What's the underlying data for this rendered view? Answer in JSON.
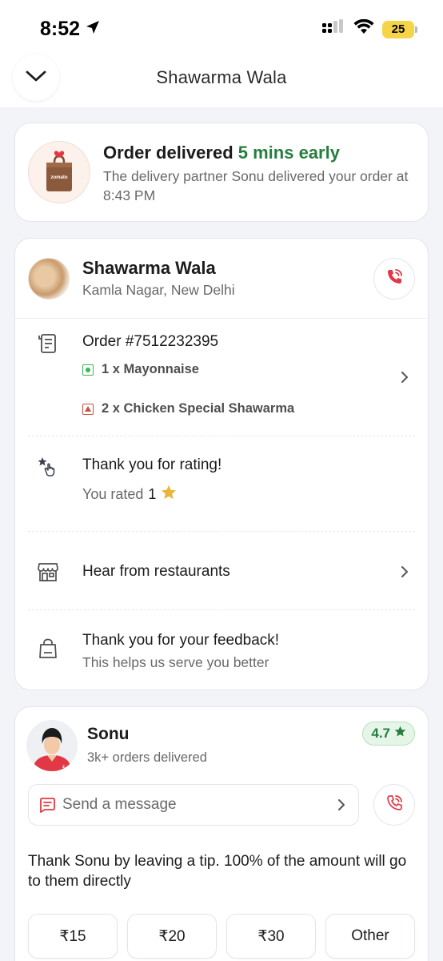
{
  "status_bar": {
    "time": "8:52",
    "battery": "25",
    "icons": [
      "location-arrow-icon",
      "cellular-signal-icon",
      "wifi-icon",
      "battery-icon"
    ]
  },
  "header": {
    "title": "Shawarma Wala",
    "back_icon": "chevron-down-icon"
  },
  "delivery_status": {
    "title_prefix": "Order delivered",
    "title_highlight": "5 mins early",
    "subtitle": "The delivery partner Sonu delivered your order at 8:43 PM",
    "icon": "zomato-bag-icon",
    "highlight_color": "#267e3e"
  },
  "restaurant": {
    "name": "Shawarma Wala",
    "location": "Kamla Nagar, New Delhi",
    "call_icon": "phone-icon"
  },
  "order": {
    "number": "Order #7512232395",
    "items": [
      {
        "text": "1 x Mayonnaise",
        "type": "veg"
      },
      {
        "text": "2 x Chicken Special Shawarma",
        "type": "non-veg"
      }
    ]
  },
  "rating": {
    "title": "Thank you for rating!",
    "label": "You rated",
    "value": "1",
    "star_color": "#e8b63a"
  },
  "hear_from_restaurants": {
    "label": "Hear from restaurants",
    "icon": "store-icon"
  },
  "feedback": {
    "title": "Thank you for your feedback!",
    "subtitle": "This helps us serve you better",
    "icon": "shopping-bag-icon"
  },
  "delivery_partner": {
    "name": "Sonu",
    "orders": "3k+ orders delivered",
    "rating": "4.7",
    "message_placeholder": "Send a message",
    "tip_text": "Thank Sonu by leaving a tip. 100% of the amount will go to them directly",
    "tips": [
      "₹15",
      "₹20",
      "₹30",
      "Other"
    ]
  },
  "colors": {
    "accent_red": "#e23744",
    "green": "#267e3e",
    "background": "#f3f4f8"
  }
}
